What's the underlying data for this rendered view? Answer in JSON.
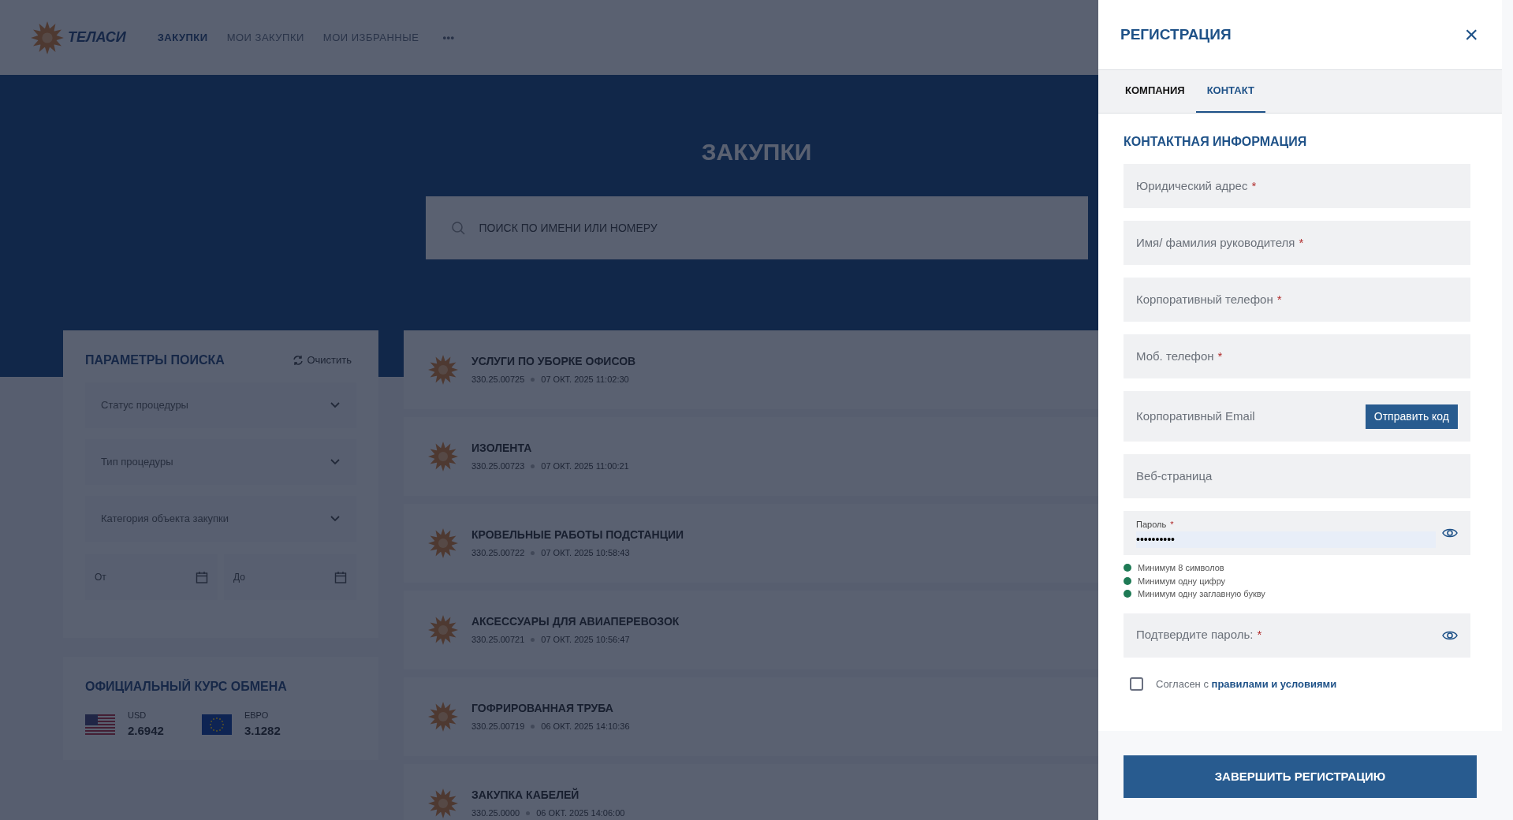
{
  "header": {
    "logo_text": "ТЕЛАСИ",
    "nav": [
      {
        "label": "ЗАКУПКИ",
        "selected": true
      },
      {
        "label": "МОИ ЗАКУПКИ",
        "selected": false
      },
      {
        "label": "МОИ ИЗБРАННЫЕ",
        "selected": false
      }
    ],
    "more": "•••"
  },
  "hero": {
    "title": "ЗАКУПКИ",
    "search_placeholder": "ПОИСК ПО ИМЕНИ ИЛИ НОМЕРУ"
  },
  "filters": {
    "title": "ПАРАМЕТРЫ ПОИСКА",
    "clear": "Очистить",
    "selects": [
      "Статус процедуры",
      "Тип процедуры",
      "Категория объекта закупки"
    ],
    "date_from": {
      "placeholder": "От"
    },
    "date_to": {
      "placeholder": "До"
    }
  },
  "rates": {
    "title": "ОФИЦИАЛЬНЫЙ КУРС ОБМЕНА",
    "items": [
      {
        "kind": "us",
        "code": "USD",
        "value": "2.6942"
      },
      {
        "kind": "eu",
        "code": "ЕВРО",
        "value": "3.1282"
      }
    ]
  },
  "tenders": [
    {
      "title": "УСЛУГИ ПО УБОРКЕ ОФИСОВ",
      "number": "330.25.00725",
      "date": "07 ОКТ. 2025 11:02:30"
    },
    {
      "title": "ИЗОЛЕНТА",
      "number": "330.25.00723",
      "date": "07 ОКТ. 2025 11:00:21"
    },
    {
      "title": "КРОВЕЛЬНЫЕ РАБОТЫ ПОДСТАНЦИИ",
      "number": "330.25.00722",
      "date": "07 ОКТ. 2025 10:58:43"
    },
    {
      "title": "АКСЕССУАРЫ ДЛЯ АВИАПЕРЕВОЗОК",
      "number": "330.25.00721",
      "date": "07 ОКТ. 2025 10:56:47"
    },
    {
      "title": "ГОФРИРОВАННАЯ ТРУБА",
      "number": "330.25.00719",
      "date": "06 ОКТ. 2025 14:10:36"
    },
    {
      "title": "ЗАКУПКА КАБЕЛЕЙ",
      "number": "330.25.0000",
      "date": "06 ОКТ. 2025 14:06:00"
    }
  ],
  "drawer": {
    "title": "РЕГИСТРАЦИЯ",
    "close": "×",
    "tabs": [
      {
        "label": "КОМПАНИЯ",
        "selected": false
      },
      {
        "label": "КОНТАКТ",
        "selected": true
      }
    ],
    "section_title": "КОНТАКТНАЯ ИНФОРМАЦИЯ",
    "fields": [
      {
        "kind": "input",
        "placeholder": "Юридический адрес",
        "required_mark": "*"
      },
      {
        "kind": "input",
        "placeholder": "Имя/ фамилия руководителя",
        "required_mark": "*"
      },
      {
        "kind": "input",
        "placeholder": "Корпоративный телефон",
        "required_mark": "*"
      },
      {
        "kind": "input",
        "placeholder": "Моб. телефон",
        "required_mark": "*"
      },
      {
        "kind": "email",
        "placeholder": "Корпоративный Email",
        "button": "Отправить код"
      },
      {
        "kind": "input",
        "placeholder": "Веб-страница"
      },
      {
        "kind": "password",
        "label": "Пароль",
        "value": "••••••••••",
        "required_mark": "*",
        "rules": [
          {
            "text": "Минимум 8 символов",
            "met": true
          },
          {
            "text": "Минимум одну цифру",
            "met": true
          },
          {
            "text": "Минимум одну заглавную букву",
            "met": true
          }
        ]
      },
      {
        "kind": "confirm",
        "placeholder": "Подтвердите пароль:",
        "required_mark": "*"
      }
    ],
    "agree": {
      "checked": false,
      "text": "Согласен с",
      "link": "правилами и условиями"
    },
    "submit": "ЗАВЕРШИТЬ РЕГИСТРАЦИЮ"
  }
}
